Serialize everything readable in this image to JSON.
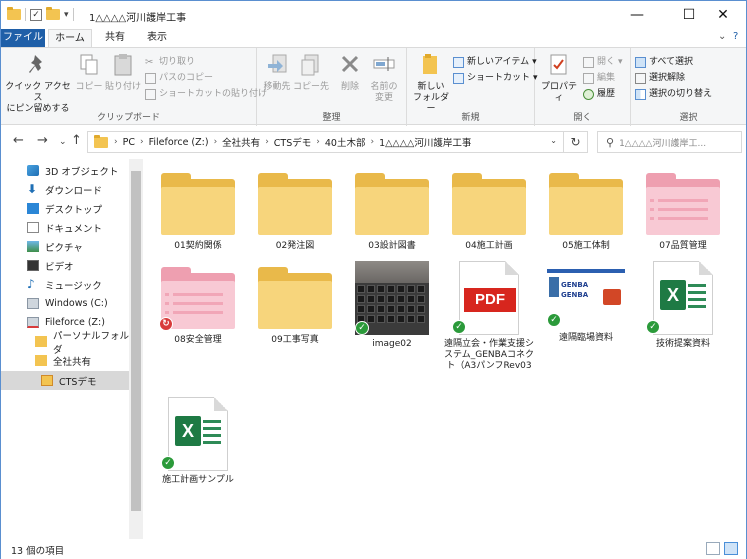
{
  "window": {
    "title": "1△△△△河川護岸工事",
    "controls": {
      "minimize": "—",
      "maximize": "☐",
      "close": "✕"
    }
  },
  "ribbon_tabs": {
    "file": "ファイル",
    "home": "ホーム",
    "share": "共有",
    "view": "表示",
    "expand": "⌄",
    "help": "?"
  },
  "ribbon": {
    "clipboard": {
      "label": "クリップボード",
      "pin_line1": "クイック アクセス",
      "pin_line2": "にピン留めする",
      "copy": "コピー",
      "paste": "貼り付け",
      "cut": "切り取り",
      "copy_path": "パスのコピー",
      "paste_shortcut": "ショートカットの貼り付け"
    },
    "organize": {
      "label": "整理",
      "move_to": "移動先",
      "copy_to": "コピー先",
      "delete": "削除",
      "rename_line1": "名前の",
      "rename_line2": "変更"
    },
    "new": {
      "label": "新規",
      "new_folder_line1": "新しい",
      "new_folder_line2": "フォルダー",
      "new_item": "新しいアイテム",
      "shortcut": "ショートカット"
    },
    "open": {
      "label": "開く",
      "properties": "プロパティ",
      "open": "開く",
      "edit": "編集",
      "history": "履歴"
    },
    "select": {
      "label": "選択",
      "select_all": "すべて選択",
      "select_none": "選択解除",
      "invert": "選択の切り替え"
    }
  },
  "address": {
    "crumbs": [
      "PC",
      "Fileforce (Z:)",
      "全社共有",
      "CTSデモ",
      "40土木部",
      "1△△△△河川護岸工事"
    ],
    "search_placeholder": "1△△△△河川護岸工..."
  },
  "nav": {
    "items": [
      {
        "label": "3D オブジェクト",
        "icon": "3d-objects-icon"
      },
      {
        "label": "ダウンロード",
        "icon": "download-icon"
      },
      {
        "label": "デスクトップ",
        "icon": "desktop-icon"
      },
      {
        "label": "ドキュメント",
        "icon": "documents-icon"
      },
      {
        "label": "ピクチャ",
        "icon": "pictures-icon"
      },
      {
        "label": "ビデオ",
        "icon": "video-icon"
      },
      {
        "label": "ミュージック",
        "icon": "music-icon"
      },
      {
        "label": "Windows (C:)",
        "icon": "drive-icon"
      },
      {
        "label": "Fileforce (Z:)",
        "icon": "cloud-drive-icon"
      },
      {
        "label": "パーソナルフォルダ",
        "icon": "folder-icon"
      },
      {
        "label": "全社共有",
        "icon": "folder-icon"
      },
      {
        "label": "CTSデモ",
        "icon": "folder-icon"
      }
    ]
  },
  "files": [
    {
      "name": "01契約関係",
      "type": "folder"
    },
    {
      "name": "02発注図",
      "type": "folder"
    },
    {
      "name": "03設計図書",
      "type": "folder"
    },
    {
      "name": "04施工計画",
      "type": "folder"
    },
    {
      "name": "05施工体制",
      "type": "folder"
    },
    {
      "name": "07品質管理",
      "type": "folder-pink"
    },
    {
      "name": "08安全管理",
      "type": "folder-pink"
    },
    {
      "name": "09工事写真",
      "type": "folder"
    },
    {
      "name": "image02",
      "type": "image"
    },
    {
      "name": "遠隔立会・作業支援システム_GENBAコネクト（A3パンフRev03",
      "type": "pdf",
      "pdf_label": "PDF"
    },
    {
      "name": "遠隔臨場資料",
      "type": "ppt",
      "thumb_line1": "GENBA",
      "thumb_line2": "GENBA"
    },
    {
      "name": "技術提案資料",
      "type": "excel",
      "excel_label": "X"
    },
    {
      "name": "施工計画サンプル",
      "type": "excel",
      "excel_label": "X"
    }
  ],
  "status": {
    "count": "13 個の項目"
  },
  "colors": {
    "file_tab": "#1f5fa8",
    "folder": "#f7d57c",
    "folder_pink": "#f8c9d4",
    "sync_ok": "#2b9a3a",
    "sync_error": "#d83b3b",
    "pdf_red": "#d7261e",
    "excel_green": "#1e7a44"
  }
}
